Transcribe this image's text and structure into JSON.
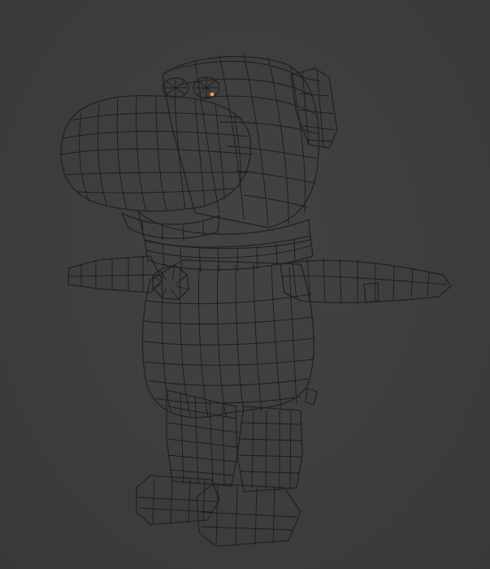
{
  "viewport": {
    "mode": "solid-shaded-wireframe",
    "background": "#3d3d3d"
  },
  "model": {
    "kind": "cartoon dog mesh",
    "surface_color": "#9a9a9a",
    "wire_color": "#1c1c1c",
    "selected_vertex_color": "#e8a040"
  },
  "icons": [
    "dog-mesh",
    "collar-tag",
    "eye-mesh"
  ]
}
